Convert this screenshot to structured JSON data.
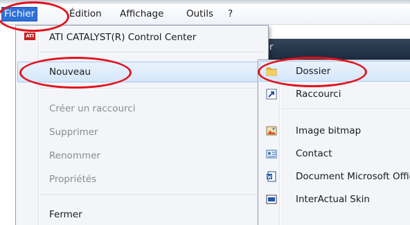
{
  "menubar": {
    "items": [
      {
        "label": "Fichier"
      },
      {
        "label": "Édition"
      },
      {
        "label": "Affichage"
      },
      {
        "label": "Outils"
      },
      {
        "label": "?"
      }
    ]
  },
  "background_window": {
    "caption_fragment": "er"
  },
  "file_menu": {
    "items": [
      {
        "label": "ATI CATALYST(R) Control Center",
        "icon": "ati-icon",
        "enabled": true
      },
      {
        "label": "Nouveau",
        "enabled": true,
        "has_submenu": true,
        "highlighted": true
      },
      {
        "label": "Créer un raccourci",
        "enabled": false
      },
      {
        "label": "Supprimer",
        "enabled": false
      },
      {
        "label": "Renommer",
        "enabled": false
      },
      {
        "label": "Propriétés",
        "enabled": false
      },
      {
        "label": "Fermer",
        "enabled": true
      }
    ],
    "ati_badge": "ATI"
  },
  "new_submenu": {
    "items": [
      {
        "label": "Dossier",
        "icon": "folder-icon",
        "highlighted": true
      },
      {
        "label": "Raccourci",
        "icon": "shortcut-icon"
      },
      {
        "label": "Image bitmap",
        "icon": "bitmap-icon"
      },
      {
        "label": "Contact",
        "icon": "contact-icon"
      },
      {
        "label": "Document Microsoft Office Word",
        "icon": "word-doc-icon"
      },
      {
        "label": "InterActual Skin",
        "icon": "interactual-icon"
      }
    ]
  },
  "colors": {
    "menu_active": "#2f6fd8",
    "highlight": "#d4e6fb",
    "annotation": "#e3121b",
    "disabled_text": "#8b8b8b"
  }
}
